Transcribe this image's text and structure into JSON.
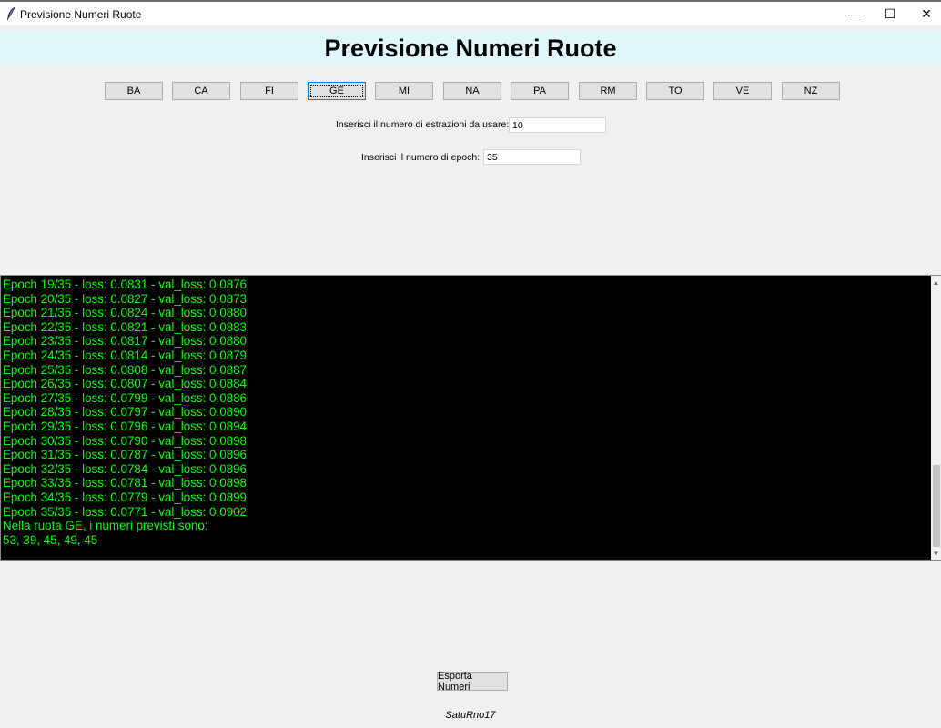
{
  "window": {
    "title": "Previsione Numeri Ruote",
    "controls": {
      "minimize": "—",
      "maximize": "☐",
      "close": "✕"
    },
    "icon": "feather-icon"
  },
  "header": {
    "title": "Previsione Numeri Ruote",
    "background": "#e0f7fa"
  },
  "wheels": [
    {
      "label": "BA",
      "focused": false
    },
    {
      "label": "CA",
      "focused": false
    },
    {
      "label": "FI",
      "focused": false
    },
    {
      "label": "GE",
      "focused": true
    },
    {
      "label": "MI",
      "focused": false
    },
    {
      "label": "NA",
      "focused": false
    },
    {
      "label": "PA",
      "focused": false
    },
    {
      "label": "RM",
      "focused": false
    },
    {
      "label": "TO",
      "focused": false
    },
    {
      "label": "VE",
      "focused": false
    },
    {
      "label": "NZ",
      "focused": false
    }
  ],
  "form": {
    "extractions": {
      "label": "Inserisci il numero di estrazioni da usare:",
      "value": "10"
    },
    "epochs": {
      "label": "Inserisci il numero di epoch:",
      "value": "35"
    }
  },
  "console": {
    "text_color": "#00ff00",
    "background": "#000000",
    "lines": [
      "Epoch 19/35 - loss: 0.0831 - val_loss: 0.0876",
      "Epoch 20/35 - loss: 0.0827 - val_loss: 0.0873",
      "Epoch 21/35 - loss: 0.0824 - val_loss: 0.0880",
      "Epoch 22/35 - loss: 0.0821 - val_loss: 0.0883",
      "Epoch 23/35 - loss: 0.0817 - val_loss: 0.0880",
      "Epoch 24/35 - loss: 0.0814 - val_loss: 0.0879",
      "Epoch 25/35 - loss: 0.0808 - val_loss: 0.0887",
      "Epoch 26/35 - loss: 0.0807 - val_loss: 0.0884",
      "Epoch 27/35 - loss: 0.0799 - val_loss: 0.0886",
      "Epoch 28/35 - loss: 0.0797 - val_loss: 0.0890",
      "Epoch 29/35 - loss: 0.0796 - val_loss: 0.0894",
      "Epoch 30/35 - loss: 0.0790 - val_loss: 0.0898",
      "Epoch 31/35 - loss: 0.0787 - val_loss: 0.0896",
      "Epoch 32/35 - loss: 0.0784 - val_loss: 0.0896",
      "Epoch 33/35 - loss: 0.0781 - val_loss: 0.0898",
      "Epoch 34/35 - loss: 0.0779 - val_loss: 0.0899",
      "Epoch 35/35 - loss: 0.0771 - val_loss: 0.0902",
      "Nella ruota GE, i numeri previsti sono:",
      "53, 39, 45, 49, 45"
    ]
  },
  "export_button": {
    "label": "Esporta Numeri"
  },
  "credit": "SatuRno17"
}
